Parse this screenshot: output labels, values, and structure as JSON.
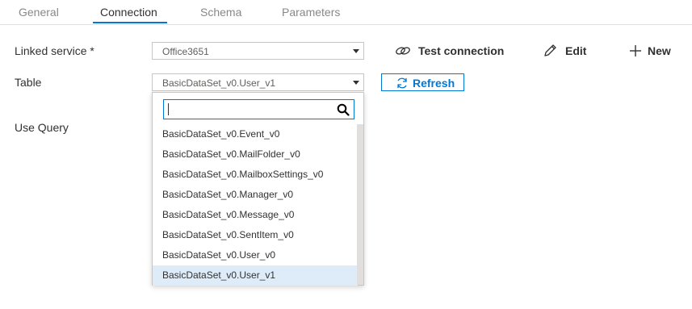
{
  "tabs": [
    {
      "label": "General",
      "active": false
    },
    {
      "label": "Connection",
      "active": true
    },
    {
      "label": "Schema",
      "active": false
    },
    {
      "label": "Parameters",
      "active": false
    }
  ],
  "linked_service": {
    "label": "Linked service *",
    "value": "Office3651"
  },
  "table": {
    "label": "Table",
    "value": "BasicDataSet_v0.User_v1"
  },
  "use_query": {
    "label": "Use Query"
  },
  "actions": {
    "test_connection": "Test connection",
    "edit": "Edit",
    "new": "New",
    "refresh": "Refresh"
  },
  "dropdown": {
    "search_value": "",
    "items": [
      "BasicDataSet_v0.Event_v0",
      "BasicDataSet_v0.MailFolder_v0",
      "BasicDataSet_v0.MailboxSettings_v0",
      "BasicDataSet_v0.Manager_v0",
      "BasicDataSet_v0.Message_v0",
      "BasicDataSet_v0.SentItem_v0",
      "BasicDataSet_v0.User_v0",
      "BasicDataSet_v0.User_v1"
    ],
    "selected_index": 7
  },
  "icons": {
    "test_connection": "link-icon",
    "edit": "pencil-icon",
    "new": "plus-icon",
    "refresh": "refresh-icon",
    "search": "search-icon"
  },
  "colors": {
    "accent": "#0078d4",
    "selected_bg": "#deecf9",
    "muted_text": "#8a8886"
  }
}
